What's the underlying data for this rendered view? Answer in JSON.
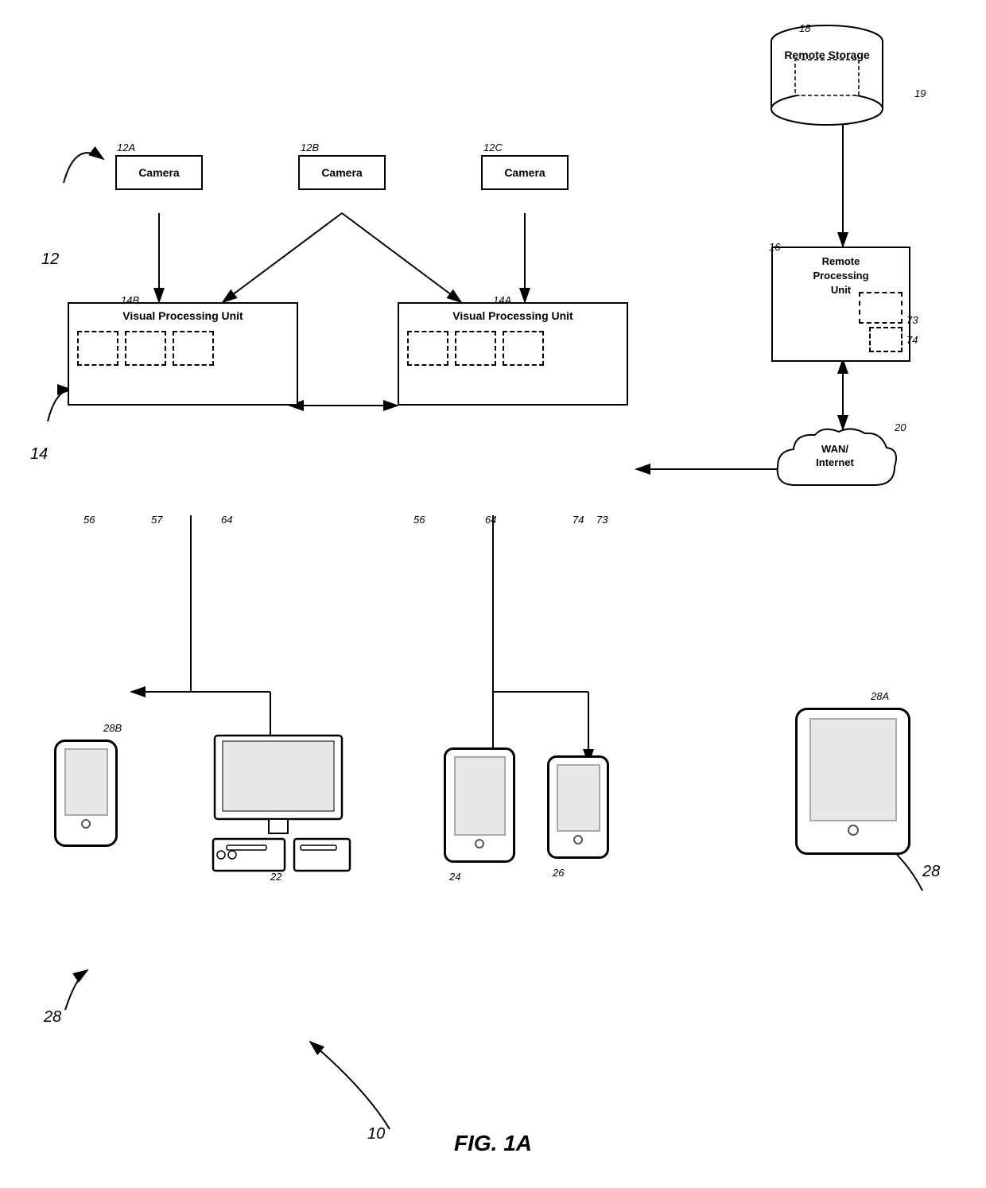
{
  "title": "FIG. 1A",
  "components": {
    "remoteStorage": {
      "label": "18",
      "sublabel": "19",
      "text": "Remote Storage"
    },
    "rpu": {
      "label": "16",
      "text": "Remote\nProcessing\nUnit",
      "sublabel1": "73",
      "sublabel2": "74"
    },
    "wan": {
      "label": "20",
      "text": "WAN/\nInternet"
    },
    "camera12A": {
      "label": "12A",
      "text": "Camera"
    },
    "camera12B": {
      "label": "12B",
      "text": "Camera"
    },
    "camera12C": {
      "label": "12C",
      "text": "Camera"
    },
    "vpu14B": {
      "label": "14B",
      "text": "Visual Processing Unit",
      "sub_labels": [
        "56",
        "57",
        "64"
      ]
    },
    "vpu14A": {
      "label": "14A",
      "text": "Visual Processing Unit",
      "sub_labels": [
        "56",
        "64",
        "74",
        "73"
      ]
    },
    "groupLabel14": "14",
    "groupLabel12": "12",
    "computer": {
      "label": "22"
    },
    "phone28B": {
      "label": "28B"
    },
    "phone28_left": {
      "label": "28"
    },
    "tablet24": {
      "label": "24"
    },
    "phone26": {
      "label": "26"
    },
    "tablet28A": {
      "label": "28A"
    },
    "label28_right": "28",
    "label28_bottom": "28",
    "label10": "10"
  }
}
